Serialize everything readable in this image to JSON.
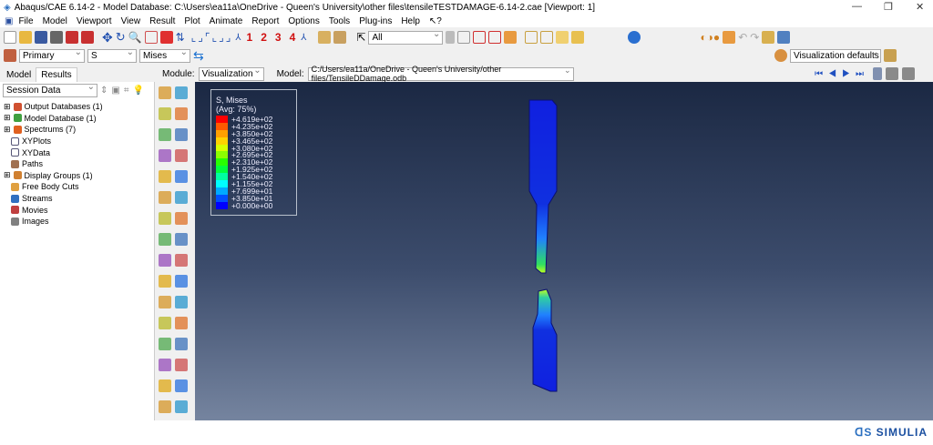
{
  "window": {
    "title": "Abaqus/CAE 6.14-2 - Model Database: C:\\Users\\ea11a\\OneDrive - Queen's University\\other files\\tensileTESTDAMAGE-6.14-2.cae [Viewport: 1]"
  },
  "menu": [
    "File",
    "Model",
    "Viewport",
    "View",
    "Result",
    "Plot",
    "Animate",
    "Report",
    "Options",
    "Tools",
    "Plug-ins",
    "Help",
    "↖?"
  ],
  "toolbar": {
    "views": [
      "1",
      "2",
      "3",
      "4"
    ],
    "selection_filter": "All",
    "primary": "Primary",
    "variable": "S",
    "invariant": "Mises",
    "visualization_defaults": "Visualization defaults"
  },
  "tabs": [
    "Model",
    "Results"
  ],
  "context": {
    "module_label": "Module:",
    "module": "Visualization",
    "model_label": "Model:",
    "model": "C:/Users/ea11a/OneDrive - Queen's University/other files/TensileDDamage.odb"
  },
  "session": {
    "dropdown": "Session Data",
    "tree": [
      "Output Databases (1)",
      "Model Database (1)",
      "Spectrums (7)",
      "XYPlots",
      "XYData",
      "Paths",
      "Display Groups (1)",
      "Free Body Cuts",
      "Streams",
      "Movies",
      "Images"
    ]
  },
  "legend": {
    "title": "S, Mises",
    "subtitle": "(Avg: 75%)",
    "values": [
      "+4.619e+02",
      "+4.235e+02",
      "+3.850e+02",
      "+3.465e+02",
      "+3.080e+02",
      "+2.695e+02",
      "+2.310e+02",
      "+1.925e+02",
      "+1.540e+02",
      "+1.155e+02",
      "+7.699e+01",
      "+3.850e+01",
      "+0.000e+00"
    ],
    "colors": [
      "#ff0000",
      "#ff5a00",
      "#ffa000",
      "#ffd200",
      "#d8ff00",
      "#8cff00",
      "#28ff00",
      "#00ff3c",
      "#00ffa0",
      "#00ffff",
      "#00aaff",
      "#0050ff",
      "#0000ff"
    ]
  },
  "brand": "SIMULIA"
}
